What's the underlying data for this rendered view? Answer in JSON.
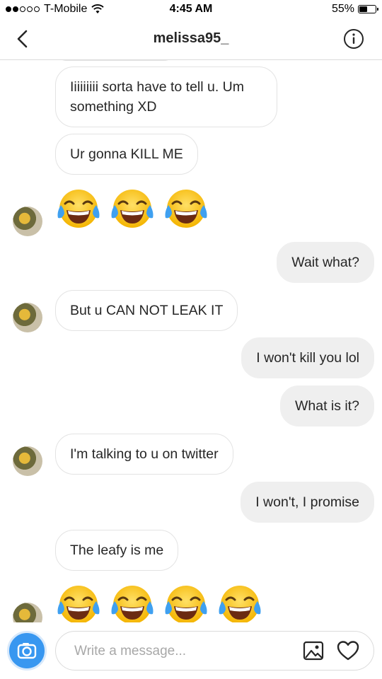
{
  "status_bar": {
    "carrier": "T-Mobile",
    "time": "4:45 AM",
    "battery_percent": "55%",
    "battery_level": 0.55,
    "signal_dots_filled": 2,
    "signal_dots_total": 5
  },
  "header": {
    "title": "melissa95_",
    "back_icon": "chevron-left-icon",
    "info_icon": "info-icon"
  },
  "messages": [
    {
      "direction": "in",
      "text": "Iiiiiiiii sorta have to tell u. Um something XD"
    },
    {
      "direction": "in",
      "text": "Ur gonna KILL ME"
    },
    {
      "direction": "in",
      "emoji": "face-with-tears-of-joy",
      "count": 3
    },
    {
      "direction": "out",
      "text": "Wait what?"
    },
    {
      "direction": "in",
      "text": "But u CAN NOT LEAK IT"
    },
    {
      "direction": "out",
      "text": "I won't kill you lol"
    },
    {
      "direction": "out",
      "text": "What is it?"
    },
    {
      "direction": "in",
      "text": "I'm talking to u on twitter"
    },
    {
      "direction": "out",
      "text": "I won't, I promise"
    },
    {
      "direction": "in",
      "text": "The leafy is me"
    },
    {
      "direction": "in",
      "emoji": "face-with-tears-of-joy",
      "count": 4
    }
  ],
  "composer": {
    "placeholder": "Write a message...",
    "camera_icon": "camera-icon",
    "gallery_icon": "image-icon",
    "like_icon": "heart-icon"
  },
  "colors": {
    "accent": "#3897f0",
    "outgoing_bubble": "#efefef",
    "incoming_border": "#e3e3e3",
    "text": "#262626",
    "placeholder": "#a8a8a8"
  }
}
